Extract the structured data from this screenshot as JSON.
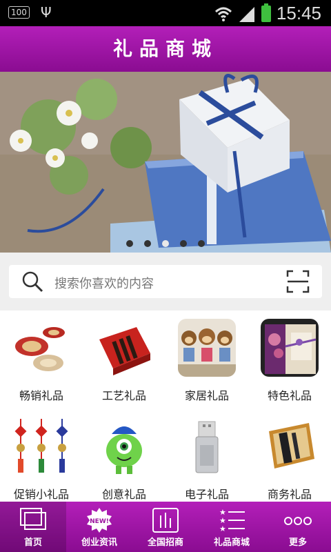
{
  "statusbar": {
    "indicator": "100",
    "time": "15:45"
  },
  "header": {
    "title": "礼品商城"
  },
  "banner": {
    "dots": 5,
    "active_dot": 3
  },
  "search": {
    "placeholder": "搜索你喜欢的内容"
  },
  "categories": [
    {
      "label": "畅销礼品",
      "icon": "tea-plates-image"
    },
    {
      "label": "工艺礼品",
      "icon": "red-gift-box-image"
    },
    {
      "label": "家居礼品",
      "icon": "monkey-dolls-image"
    },
    {
      "label": "特色礼品",
      "icon": "purple-gift-box-image"
    },
    {
      "label": "促销小礼品",
      "icon": "chinese-knot-image"
    },
    {
      "label": "创意礼品",
      "icon": "monster-toy-image"
    },
    {
      "label": "电子礼品",
      "icon": "usb-drive-image"
    },
    {
      "label": "商务礼品",
      "icon": "business-gift-set-image"
    }
  ],
  "tabs": [
    {
      "label": "首页",
      "icon": "home-icon",
      "active": true
    },
    {
      "label": "创业资讯",
      "icon": "new-badge-icon",
      "active": false
    },
    {
      "label": "全国招商",
      "icon": "chart-icon",
      "active": false
    },
    {
      "label": "礼品商城",
      "icon": "star-list-icon",
      "active": false
    },
    {
      "label": "更多",
      "icon": "more-icon",
      "active": false
    }
  ],
  "colors": {
    "brand": "#9c149f",
    "brand_light": "#b31fb9"
  }
}
